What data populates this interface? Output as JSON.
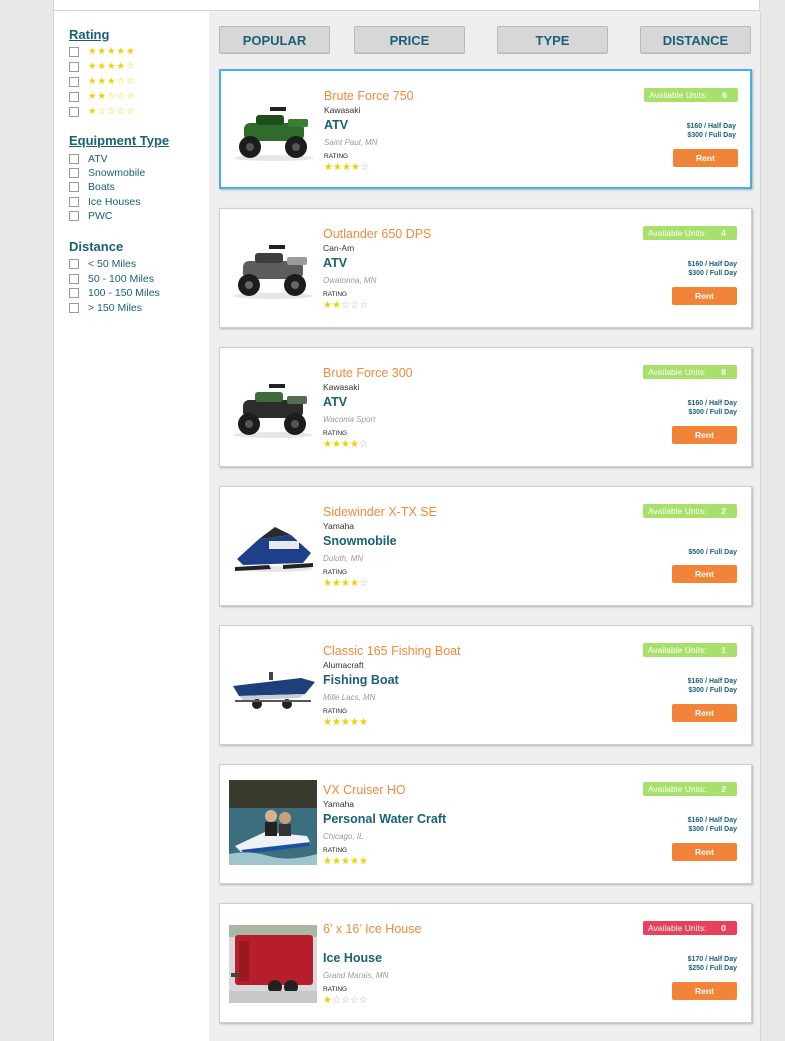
{
  "filters": {
    "rating": {
      "title": "Rating",
      "options": [
        {
          "stars": "★★★★★"
        },
        {
          "stars": "★★★★☆"
        },
        {
          "stars": "★★★☆☆"
        },
        {
          "stars": "★★☆☆☆"
        },
        {
          "stars": "★☆☆☆☆"
        }
      ]
    },
    "equipment": {
      "title": "Equipment Type",
      "options": [
        "ATV",
        "Snowmobile",
        "Boats",
        "Ice Houses",
        "PWC"
      ]
    },
    "distance": {
      "title": "Distance",
      "options": [
        "< 50 Miles",
        "50 - 100 Miles",
        "100 - 150 Miles",
        "> 150 Miles"
      ]
    }
  },
  "sort": {
    "popular": "POPULAR",
    "price": "PRICE",
    "type": "TYPE",
    "distance": "DISTANCE"
  },
  "labels": {
    "available": "Available Units:",
    "rating": "RATING",
    "rent": "Rent"
  },
  "listings": [
    {
      "name": "Brute Force 750",
      "brand": "Kawasaki",
      "type": "ATV",
      "location": "Saint Paul, MN",
      "rating": 4,
      "units": "6",
      "price_half": "$160 / Half Day",
      "price_full": "$300 / Full Day",
      "image": "atv-green-icon"
    },
    {
      "name": "Outlander 650 DPS",
      "brand": "Can-Am",
      "type": "ATV",
      "location": "Owatonna, MN",
      "rating": 2,
      "units": "4",
      "price_half": "$160 / Half Day",
      "price_full": "$300 / Full Day",
      "image": "atv-gray-icon"
    },
    {
      "name": "Brute Force 300",
      "brand": "Kawasaki",
      "type": "ATV",
      "location": "Waconia Sport",
      "rating": 4,
      "units": "8",
      "price_half": "$160 / Half Day",
      "price_full": "$300 / Full Day",
      "image": "atv-dark-icon"
    },
    {
      "name": "Sidewinder X-TX SE",
      "brand": "Yamaha",
      "type": "Snowmobile",
      "location": "Duluth, MN",
      "rating": 4,
      "units": "2",
      "price_half": "",
      "price_full": "$500 / Full Day",
      "image": "snowmobile-icon"
    },
    {
      "name": "Classic 165 Fishing Boat",
      "brand": "Alumacraft",
      "type": "Fishing Boat",
      "location": "Mille Lacs, MN",
      "rating": 5,
      "units": "1",
      "price_half": "$160 / Half Day",
      "price_full": "$300 / Full Day",
      "image": "boat-icon"
    },
    {
      "name": "VX Cruiser HO",
      "brand": "Yamaha",
      "type": "Personal Water Craft",
      "location": "Chicago, IL",
      "rating": 5,
      "units": "2",
      "price_half": "$160 / Half Day",
      "price_full": "$300 / Full Day",
      "image": "jetski-icon"
    },
    {
      "name": "6’ x 16’ Ice House",
      "brand": "",
      "type": "Ice House",
      "location": "Grand Marais, MN",
      "rating": 1,
      "units": "0",
      "price_half": "$170 / Half Day",
      "price_full": "$250 / Full Day",
      "image": "ice-house-icon"
    }
  ],
  "colors": {
    "accent_orange": "#f28a3c",
    "primary_teal": "#1b6079",
    "available_green": "#a8e06c",
    "unavailable_red": "#e8405a",
    "selected_border": "#46b0e6"
  }
}
